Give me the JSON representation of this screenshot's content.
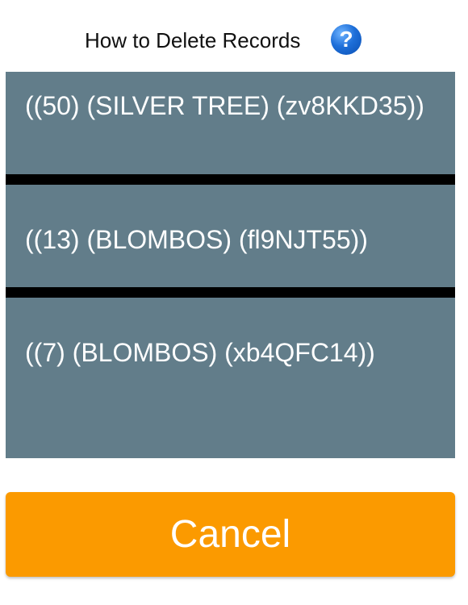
{
  "header": {
    "title": "How to Delete Records",
    "help_icon": "?"
  },
  "records": [
    {
      "label": "((50) (SILVER TREE) (zv8KKD35))"
    },
    {
      "label": "((13) (BLOMBOS) (fl9NJT55))"
    },
    {
      "label": "((7) (BLOMBOS) (xb4QFC14))"
    }
  ],
  "cancel_label": "Cancel",
  "colors": {
    "record_bg": "#627d8a",
    "separator": "#000000",
    "cancel_bg": "#fb9a00",
    "help_icon": "#1e6fd9"
  }
}
